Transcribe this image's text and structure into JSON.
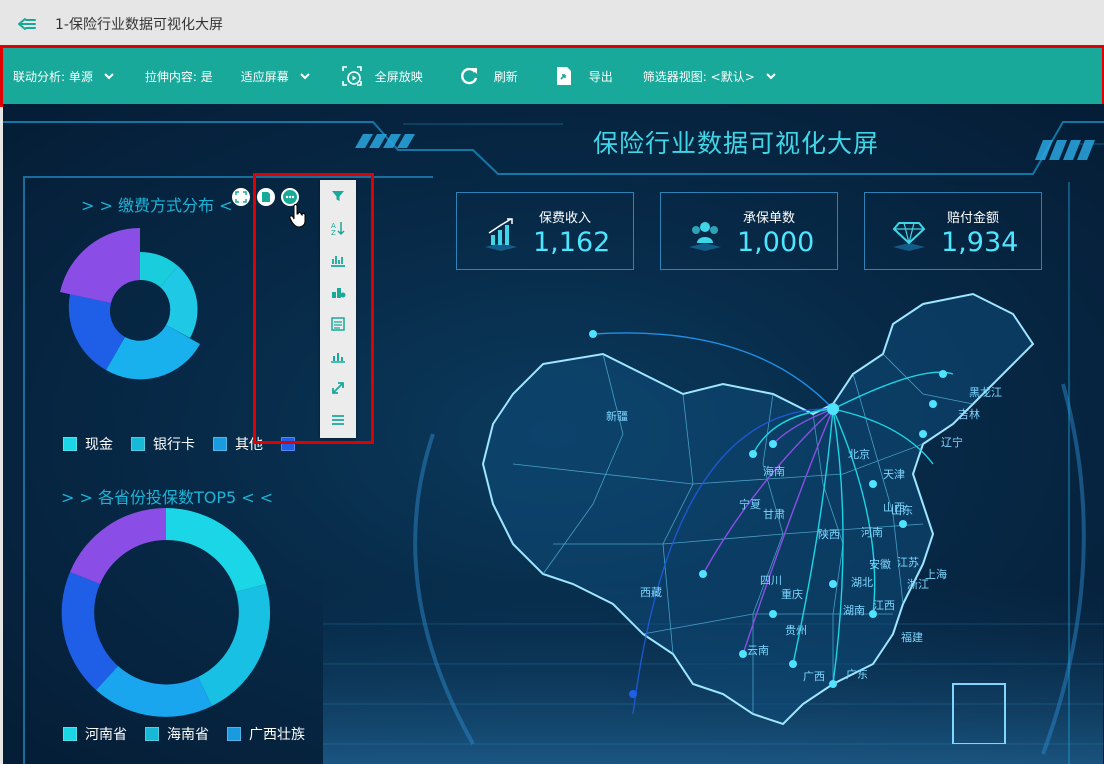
{
  "window": {
    "title": "1-保险行业数据可视化大屏"
  },
  "toolbar": {
    "linkage_label": "联动分析: 单源",
    "stretch_label": "拉伸内容: 是",
    "fit_label": "适应屏幕",
    "fullscreen_label": "全屏放映",
    "refresh_label": "刷新",
    "export_label": "导出",
    "filter_view_label": "筛选器视图: <默认>"
  },
  "dashboard": {
    "title": "保险行业数据可视化大屏",
    "kpis": [
      {
        "label": "保费收入",
        "value": "1,162"
      },
      {
        "label": "承保单数",
        "value": "1,000"
      },
      {
        "label": "赔付金额",
        "value": "1,934"
      }
    ],
    "payment_section": {
      "title": "> > 缴费方式分布 <",
      "legend": [
        "现金",
        "银行卡",
        "其他",
        ""
      ]
    },
    "province_section": {
      "title": "> > 各省份投保数TOP5 < <",
      "legend": [
        "河南省",
        "海南省",
        "广西壮族"
      ]
    },
    "map_labels": [
      "新疆",
      "黑龙江",
      "吉林",
      "辽宁",
      "北京",
      "天津",
      "海南",
      "宁夏",
      "甘肃",
      "山西",
      "山东",
      "陕西",
      "河南",
      "安徽",
      "江苏",
      "上海",
      "浙江",
      "湖北",
      "四川",
      "重庆",
      "湖南",
      "江西",
      "贵州",
      "福建",
      "云南",
      "广西",
      "广东",
      "西藏"
    ]
  },
  "colors": {
    "toolbar_bg": "#18a99a",
    "accent": "#3fd6e8",
    "highlight_border": "#e00000",
    "purple": "#8a4ee6",
    "blue": "#1f5fe8",
    "cyan": "#1ad6e6",
    "sky": "#19b0ee"
  },
  "chart_data": [
    {
      "type": "pie",
      "title": "> > 缴费方式分布 <",
      "categories": [
        "现金",
        "银行卡",
        "其他",
        ""
      ],
      "values": [
        24,
        20,
        28,
        28
      ]
    },
    {
      "type": "pie",
      "title": "> > 各省份投保数TOP5 < <",
      "categories": [
        "河南省",
        "海南省",
        "广西壮族"
      ],
      "values": [
        36,
        28,
        36
      ]
    }
  ],
  "icons": [
    "back-arrow-icon",
    "chevron-down-icon",
    "fullscreen-play-icon",
    "refresh-icon",
    "export-icon",
    "filter-icon",
    "sort-icon",
    "chart-icon",
    "chart-type-icon",
    "table-icon",
    "bar-chart-icon",
    "expand-icon",
    "list-icon"
  ]
}
